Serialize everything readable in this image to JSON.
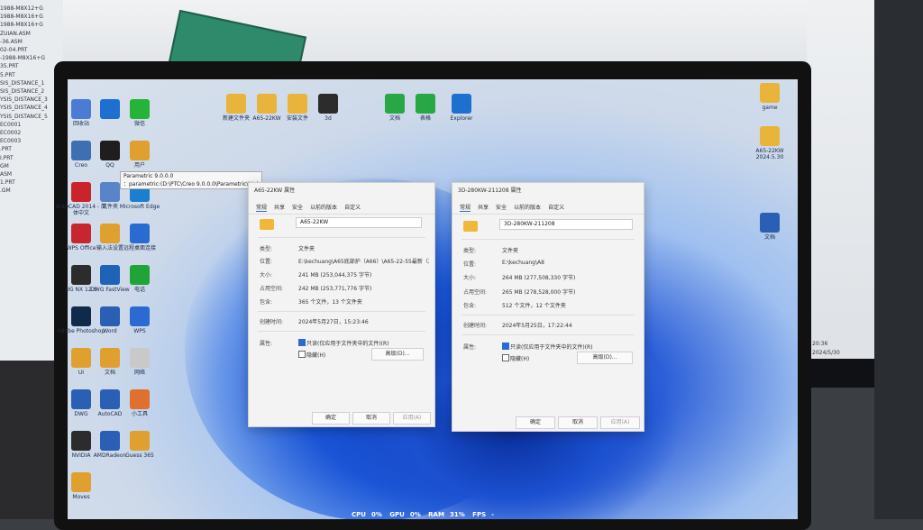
{
  "left_monitor": {
    "lines": [
      "1988-M8X12+G",
      "1988-M8X16+G",
      "1988-M8X16+G",
      "ZUIAN.ASM",
      "-36.ASM",
      "02-04.PRT",
      "-1988-M8X16+G",
      "35.PRT",
      "5.PRT",
      "SIS_DISTANCE_1",
      "SIS_DISTANCE_2",
      "YSIS_DISTANCE_3",
      "YSIS_DISTANCE_4",
      "YSIS_DISTANCE_5",
      "EC0001",
      "EC0002",
      "EC0003",
      ".PRT",
      "I.PRT",
      "GM",
      "ASM",
      "1.PRT",
      ".GM"
    ]
  },
  "right_monitor": {
    "clock": "20:36",
    "date": "2024/5/30"
  },
  "tooltip": {
    "lines": [
      "Parametric 9.0.0.0",
      "：parametric:(D:\\PTC\\Creo 9.0.0.0\\Parametric\\bin)"
    ]
  },
  "desktop_icons": [
    {
      "id": "rec",
      "label": "回收站",
      "color": "#4b7bd3"
    },
    {
      "id": "dl",
      "label": "",
      "color": "#1f6fd0"
    },
    {
      "id": "wechat",
      "label": "微信",
      "color": "#25b33a"
    },
    {
      "id": "creo",
      "label": "Creo",
      "color": "#3f6fb0"
    },
    {
      "id": "qq",
      "label": "QQ",
      "color": "#1e1e1e"
    },
    {
      "id": "user",
      "label": "用户",
      "color": "#e0a030"
    },
    {
      "id": "cad",
      "label": "AutoCAD 2014 - 简体中文",
      "color": "#c9242b"
    },
    {
      "id": "fw",
      "label": "文件夹",
      "color": "#5a84c8"
    },
    {
      "id": "edge",
      "label": "Microsoft Edge",
      "color": "#1b7fd0"
    },
    {
      "id": "wps",
      "label": "WPS Office",
      "color": "#c8262e"
    },
    {
      "id": "pinyin",
      "label": "输入法设置",
      "color": "#e0a030"
    },
    {
      "id": "rdp",
      "label": "远程桌面连接",
      "color": "#2b6bd1"
    },
    {
      "id": "ug",
      "label": "UG NX 12.0",
      "color": "#2c2c2c"
    },
    {
      "id": "dwg",
      "label": "DWG FastView",
      "color": "#1e63b6"
    },
    {
      "id": "phone",
      "label": "电话",
      "color": "#21a33a"
    },
    {
      "id": "ps",
      "label": "Adobe Photoshop",
      "color": "#0f2a4a"
    },
    {
      "id": "word",
      "label": "Word",
      "color": "#2b5fb3"
    },
    {
      "id": "wx",
      "label": "WPS",
      "color": "#2b6bd1"
    },
    {
      "id": "f2",
      "label": "UI",
      "color": "#e0a030"
    },
    {
      "id": "f3",
      "label": "文档",
      "color": "#e0a030"
    },
    {
      "id": "wm",
      "label": "网络",
      "color": "#c9c9c9"
    },
    {
      "id": "dwg2",
      "label": "DWG",
      "color": "#2b5fb3"
    },
    {
      "id": "w2",
      "label": "AutoCAD",
      "color": "#2b5fb3"
    },
    {
      "id": "c1",
      "label": "小工具",
      "color": "#e07030"
    },
    {
      "id": "nv",
      "label": "NVIDIA",
      "color": "#2c2c2c"
    },
    {
      "id": "arr",
      "label": "AMDRadeon",
      "color": "#2b5fb3"
    },
    {
      "id": "f4",
      "label": "Guess 365",
      "color": "#e0a030"
    },
    {
      "id": "f5",
      "label": "Moves",
      "color": "#e0a030"
    }
  ],
  "top_icons": [
    {
      "id": "t1",
      "label": "新建文件夹"
    },
    {
      "id": "t2",
      "label": "A65-22KW"
    },
    {
      "id": "t3",
      "label": "安装文件"
    },
    {
      "id": "t4",
      "label": "3d"
    },
    {
      "id": "t5",
      "label": "文档"
    },
    {
      "id": "t6",
      "label": "表格"
    },
    {
      "id": "t7",
      "label": "Explorer"
    }
  ],
  "right_icons": [
    {
      "id": "r1",
      "label": "game"
    },
    {
      "id": "r2",
      "label": "A65-22KW 2024.5.30"
    },
    {
      "id": "r3",
      "label": "文档"
    }
  ],
  "dialog1": {
    "title": "A65-22KW 属性",
    "tabs": [
      "常规",
      "共享",
      "安全",
      "以前的版本",
      "自定义"
    ],
    "name": "A65-22KW",
    "type_label": "类型:",
    "type_value": "文件夹",
    "location_label": "位置:",
    "location_value": "E:\\kechuang\\A65底部护（A66）\\A65-22-55最新（24",
    "size_label": "大小:",
    "size_value": "241 MB (253,044,375 字节)",
    "disk_label": "占用空间:",
    "disk_value": "242 MB (253,771,776 字节)",
    "contains_label": "包含:",
    "contains_value": "365 个文件，13 个文件夹",
    "created_label": "创建时间:",
    "created_value": "2024年5月27日，15:23:46",
    "attr_label": "属性:",
    "readonly_label": "只读(仅应用于文件夹中的文件)(R)",
    "hidden_label": "隐藏(H)",
    "advanced_label": "高级(D)...",
    "ok_label": "确定",
    "cancel_label": "取消",
    "apply_label": "应用(A)"
  },
  "dialog2": {
    "title": "3D-280KW-211208 属性",
    "tabs": [
      "常规",
      "共享",
      "安全",
      "以前的版本",
      "自定义"
    ],
    "name": "3D-280KW-211208",
    "type_label": "类型:",
    "type_value": "文件夹",
    "location_label": "位置:",
    "location_value": "E:\\kechuang\\A8",
    "size_label": "大小:",
    "size_value": "264 MB (277,508,330 字节)",
    "disk_label": "占用空间:",
    "disk_value": "265 MB (278,528,000 字节)",
    "contains_label": "包含:",
    "contains_value": "512 个文件，12 个文件夹",
    "created_label": "创建时间:",
    "created_value": "2024年5月25日，17:22:44",
    "attr_label": "属性:",
    "readonly_label": "只读(仅应用于文件夹中的文件)(R)",
    "hidden_label": "隐藏(H)",
    "advanced_label": "高级(D)...",
    "ok_label": "确定",
    "cancel_label": "取消",
    "apply_label": "应用(A)"
  },
  "status_bar": {
    "cpu_label": "CPU",
    "cpu_value": "0%",
    "gpu_label": "GPU",
    "gpu_value": "0%",
    "ram_label": "RAM",
    "ram_value": "31%",
    "fps_label": "FPS",
    "fps_value": "-"
  }
}
